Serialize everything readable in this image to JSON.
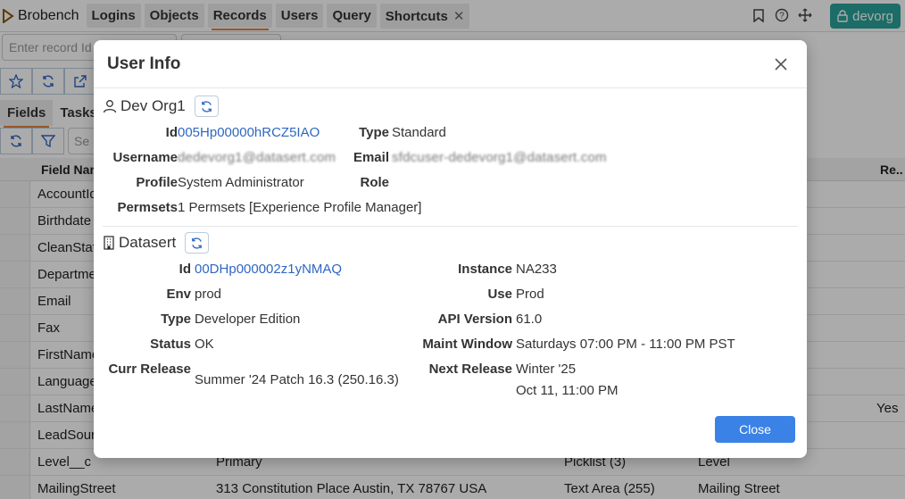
{
  "app": {
    "name": "Brobench"
  },
  "nav": {
    "tabs": [
      "Logins",
      "Objects",
      "Records",
      "Users",
      "Query",
      "Shortcuts"
    ],
    "org_label": "devorg"
  },
  "record_input": {
    "placeholder": "Enter record Id"
  },
  "subtabs": [
    "Fields",
    "Tasks"
  ],
  "filter": {
    "placeholder": "Se"
  },
  "grid": {
    "headers": [
      "Field Name",
      "Re.."
    ],
    "rows": [
      {
        "name": "AccountId",
        "value": "",
        "type": "",
        "label": "",
        "req": ""
      },
      {
        "name": "Birthdate",
        "value": "",
        "type": "",
        "label": "",
        "req": ""
      },
      {
        "name": "CleanStatus",
        "value": "",
        "type": "",
        "label": "",
        "req": ""
      },
      {
        "name": "Department",
        "value": "",
        "type": "",
        "label": "",
        "req": ""
      },
      {
        "name": "Email",
        "value": "",
        "type": "",
        "label": "",
        "req": ""
      },
      {
        "name": "Fax",
        "value": "",
        "type": "",
        "label": "",
        "req": ""
      },
      {
        "name": "FirstName",
        "value": "",
        "type": "",
        "label": "",
        "req": ""
      },
      {
        "name": "LanguagePref",
        "value": "",
        "type": "",
        "label": "",
        "req": ""
      },
      {
        "name": "LastName",
        "value": "",
        "type": "",
        "label": "",
        "req": "Yes"
      },
      {
        "name": "LeadSource",
        "value": "",
        "type": "",
        "label": "",
        "req": ""
      },
      {
        "name": "Level__c",
        "value": "Primary",
        "type": "Picklist (3)",
        "label": "Level",
        "req": ""
      },
      {
        "name": "MailingStreet",
        "value": "313 Constitution Place Austin, TX 78767 USA",
        "type": "Text Area (255)",
        "label": "Mailing Street",
        "req": ""
      }
    ]
  },
  "modal": {
    "title": "User Info",
    "user_section": {
      "name": "Dev Org1",
      "id_label": "Id",
      "id_value": "005Hp00000hRCZ5IAO",
      "type_label": "Type",
      "type_value": "Standard",
      "username_label": "Username",
      "username_value": "dedevorg1@datasert.com",
      "email_label": "Email",
      "email_value": "sfdcuser-dedevorg1@datasert.com",
      "profile_label": "Profile",
      "profile_value": "System Administrator",
      "role_label": "Role",
      "role_value": "",
      "permsets_label": "Permsets",
      "permsets_value": "1 Permsets [Experience Profile Manager]"
    },
    "org_section": {
      "name": "Datasert",
      "id_label": "Id",
      "id_value": "00DHp000002z1yNMAQ",
      "instance_label": "Instance",
      "instance_value": "NA233",
      "env_label": "Env",
      "env_value": "prod",
      "use_label": "Use",
      "use_value": "Prod",
      "type_label": "Type",
      "type_value": "Developer Edition",
      "api_label": "API Version",
      "api_value": "61.0",
      "status_label": "Status",
      "status_value": "OK",
      "maint_label": "Maint Window",
      "maint_value": "Saturdays 07:00 PM - 11:00 PM PST",
      "curr_label": "Curr Release",
      "curr_value": "Summer '24 Patch 16.3 (250.16.3)",
      "next_label": "Next Release",
      "next_value_1": "Winter '25",
      "next_value_2": "Oct 11, 11:00 PM"
    },
    "close_label": "Close"
  },
  "colors": {
    "accent": "#2aa19a",
    "primary": "#3b82e6",
    "link": "#2f66c3",
    "tab_underline": "#e08040"
  }
}
